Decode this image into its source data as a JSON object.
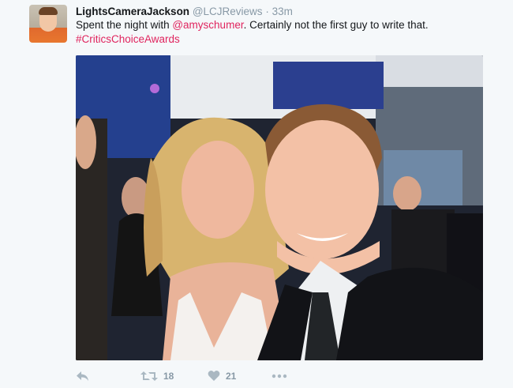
{
  "tweet": {
    "display_name": "LightsCameraJackson",
    "handle": "@LCJReviews",
    "separator": "·",
    "time": "33m",
    "text_before": "Spent the night with ",
    "mention": "@amyschumer",
    "text_after": ". Certainly not the first guy to write that.",
    "hashtag": "#CriticsChoiceAwards"
  },
  "actions": {
    "reply_icon": "reply-icon",
    "retweet_icon": "retweet-icon",
    "retweet_count": "18",
    "like_icon": "heart-icon",
    "like_count": "21",
    "more_icon": "more-icon"
  },
  "colors": {
    "accent": "#e0245e",
    "muted": "#8899a6",
    "text": "#14171a",
    "background": "#f5f8fa"
  }
}
